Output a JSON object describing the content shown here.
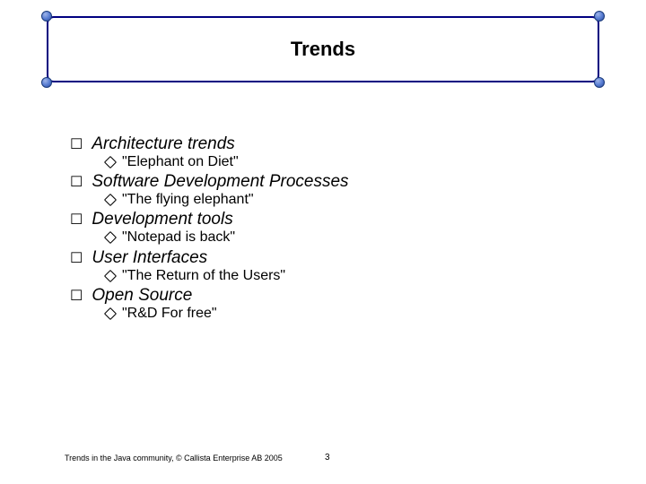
{
  "title": "Trends",
  "items": [
    {
      "label": "Architecture trends",
      "sub": "\"Elephant on Diet\""
    },
    {
      "label": "Software Development Processes",
      "sub": "\"The flying elephant\""
    },
    {
      "label": "Development tools",
      "sub": "\"Notepad is back\""
    },
    {
      "label": "User Interfaces",
      "sub": "\"The Return of the Users\""
    },
    {
      "label": "Open Source",
      "sub": "\"R&D For free\""
    }
  ],
  "footer": "Trends in the Java community, © Callista Enterprise AB 2005",
  "page": "3"
}
